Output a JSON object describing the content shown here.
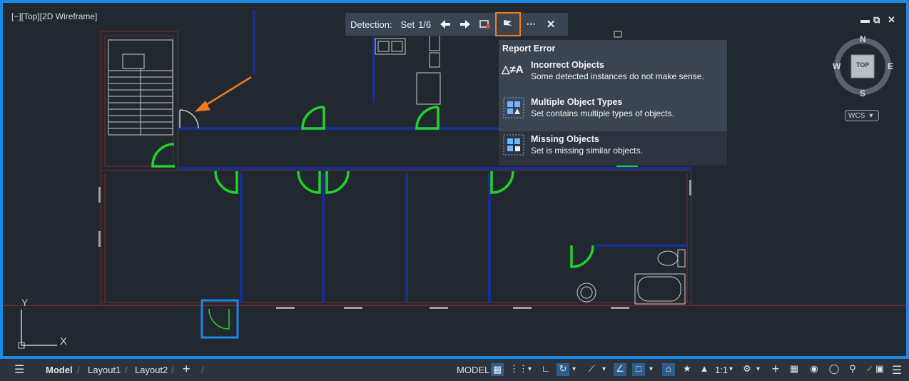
{
  "viewport": {
    "label": "[−][Top][2D Wireframe]"
  },
  "toolbar": {
    "detection_label": "Detection:",
    "set_label": "Set",
    "set_count": "1/6"
  },
  "menu": {
    "header": "Report Error",
    "items": [
      {
        "title": "Incorrect Objects",
        "desc": "Some detected instances do not make sense.",
        "icon": "triangle-not-equal-a-icon"
      },
      {
        "title": "Multiple Object Types",
        "desc": "Set contains multiple types of objects.",
        "icon": "multiple-types-icon"
      },
      {
        "title": "Missing Objects",
        "desc": "Set is missing similar objects.",
        "icon": "missing-objects-icon"
      }
    ]
  },
  "viewcube": {
    "north": "N",
    "south": "S",
    "east": "E",
    "west": "W",
    "face": "TOP",
    "wcs": "WCS"
  },
  "ucs": {
    "y": "Y",
    "x": "X"
  },
  "tabs": {
    "model": "Model",
    "layout1": "Layout1",
    "layout2": "Layout2",
    "add": "+"
  },
  "status": {
    "model": "MODEL",
    "scale": "1:1"
  },
  "colors": {
    "accent": "#1e88e5",
    "highlight": "#f07c1f",
    "door": "#22d32c",
    "wall": "#1c2e8c",
    "wall_outline": "#7a2a2a"
  }
}
